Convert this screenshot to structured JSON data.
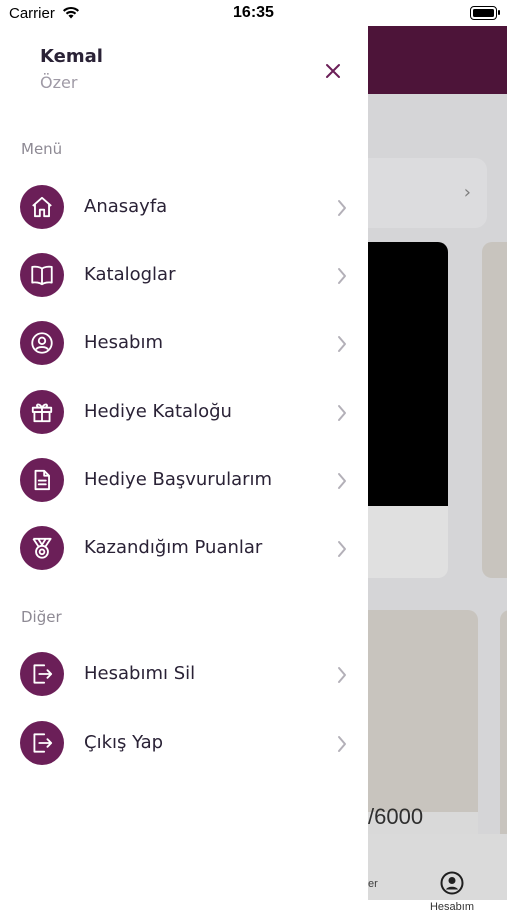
{
  "status_bar": {
    "carrier": "Carrier",
    "time": "16:35"
  },
  "profile": {
    "first_name": "Kemal",
    "last_name": "Özer"
  },
  "sections": {
    "menu_title": "Menü",
    "other_title": "Diğer"
  },
  "menu_items": [
    {
      "label": "Anasayfa",
      "icon": "home-icon"
    },
    {
      "label": "Kataloglar",
      "icon": "book-icon"
    },
    {
      "label": "Hesabım",
      "icon": "user-circle-icon"
    },
    {
      "label": "Hediye Kataloğu",
      "icon": "gift-icon"
    },
    {
      "label": "Hediye Başvurularım",
      "icon": "document-icon"
    },
    {
      "label": "Kazandığım Puanlar",
      "icon": "medal-icon"
    }
  ],
  "other_items": [
    {
      "label": "Hesabımı Sil",
      "icon": "logout-icon"
    },
    {
      "label": "Çıkış Yap",
      "icon": "logout-icon"
    }
  ],
  "background": {
    "points_text": "/6000",
    "tab_partial": "er",
    "tab_account": "Hesabım"
  },
  "colors": {
    "accent": "#6b1f58",
    "header": "#54163e"
  }
}
